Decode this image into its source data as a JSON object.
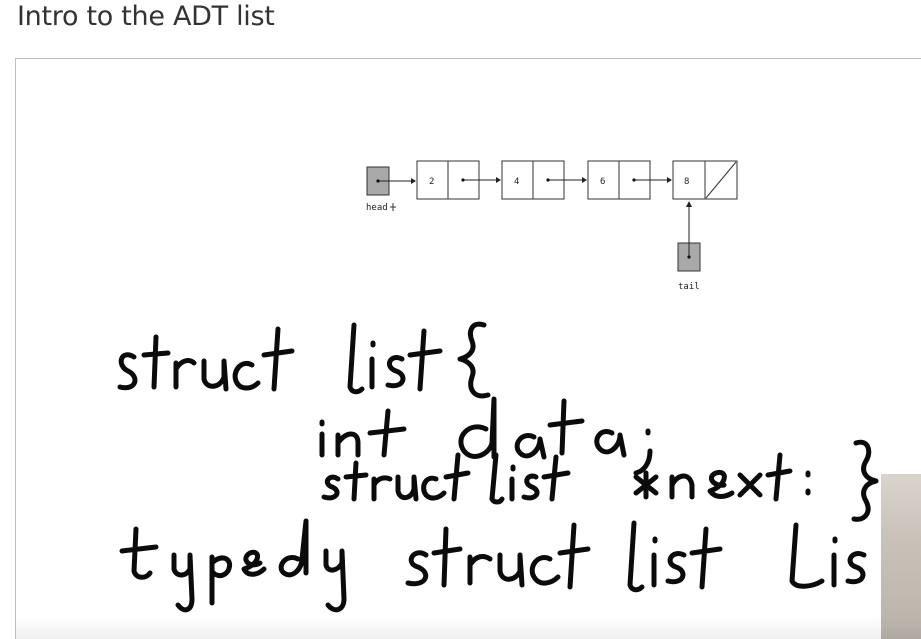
{
  "page": {
    "title": "Intro to the ADT list"
  },
  "diagram": {
    "nodes": [
      "2",
      "4",
      "6",
      "8"
    ],
    "head_label": "head",
    "tail_label": "tail"
  },
  "whiteboard": {
    "lines": [
      "struct list {",
      "int data;",
      "struct list *next; }",
      "typedef struct list list"
    ]
  }
}
